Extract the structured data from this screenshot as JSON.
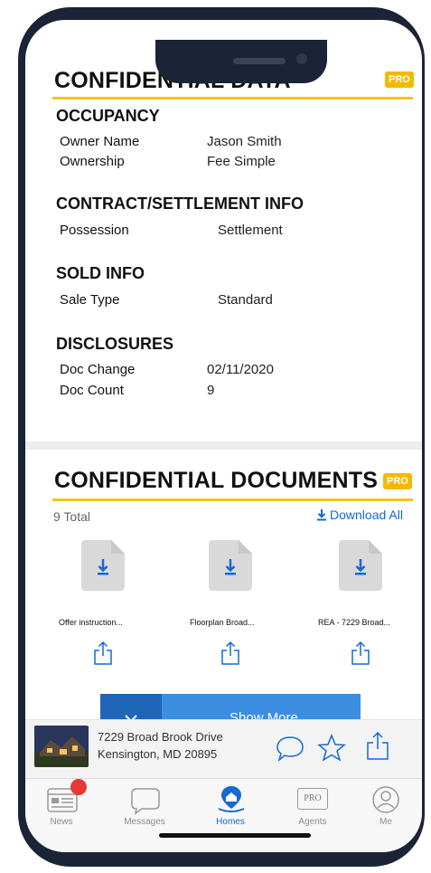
{
  "section1": {
    "title": "CONFIDENTIAL DATA",
    "badge": "PRO",
    "occupancy": {
      "heading": "OCCUPANCY",
      "rows": [
        {
          "label": "Owner Name",
          "value": "Jason Smith"
        },
        {
          "label": "Ownership",
          "value": "Fee Simple"
        }
      ]
    },
    "contract": {
      "heading": "CONTRACT/SETTLEMENT INFO",
      "rows": [
        {
          "label": "Possession",
          "value": "Settlement"
        }
      ]
    },
    "sold": {
      "heading": "SOLD INFO",
      "rows": [
        {
          "label": "Sale Type",
          "value": "Standard"
        }
      ]
    },
    "disclosures": {
      "heading": "DISCLOSURES",
      "rows": [
        {
          "label": "Doc Change",
          "value": "02/11/2020"
        },
        {
          "label": "Doc Count",
          "value": "9"
        }
      ]
    }
  },
  "section2": {
    "title": "CONFIDENTIAL DOCUMENTS",
    "badge": "PRO",
    "total": "9 Total",
    "download_all": "Download All",
    "documents": [
      {
        "name": "Offer instruction..."
      },
      {
        "name": "Floorplan Broad..."
      },
      {
        "name": "REA - 7229 Broad..."
      }
    ],
    "show_more": "Show More"
  },
  "listing": {
    "address1": "7229 Broad Brook Drive",
    "address2": "Kensington, MD 20895"
  },
  "tabs": [
    {
      "label": "News",
      "icon": "news-icon"
    },
    {
      "label": "Messages",
      "icon": "message-icon"
    },
    {
      "label": "Homes",
      "icon": "homes-icon"
    },
    {
      "label": "Agents",
      "icon": "pro-agents-icon"
    },
    {
      "label": "Me",
      "icon": "profile-icon"
    }
  ],
  "tab_agents_icon_text": "PRO",
  "colors": {
    "accent": "#1469d3",
    "pro_badge": "#f5b800",
    "rule": "#f5c423",
    "frame": "#1b2336",
    "notification": "#e53935"
  }
}
